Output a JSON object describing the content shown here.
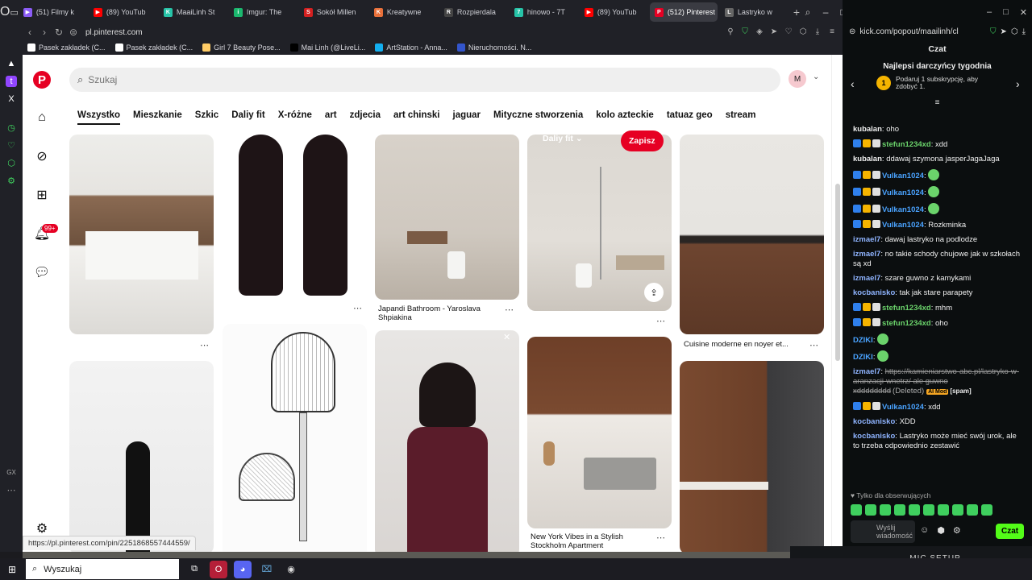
{
  "browser": {
    "tabs": [
      {
        "label": "(51) Filmy k",
        "color": "#8b5cf6",
        "glyph": "▶"
      },
      {
        "label": "(89) YouTub",
        "color": "#ff0000",
        "glyph": "▶"
      },
      {
        "label": "MaaiLinh St",
        "color": "#27c4a8",
        "glyph": "K"
      },
      {
        "label": "Imgur: The",
        "color": "#1bb76e",
        "glyph": "i"
      },
      {
        "label": "Sokół Millen",
        "color": "#d42020",
        "glyph": "S"
      },
      {
        "label": "Kreatywne",
        "color": "#e8703a",
        "glyph": "K"
      },
      {
        "label": "Rozpierdala",
        "color": "#444",
        "glyph": "R"
      },
      {
        "label": "hinowo - 7T",
        "color": "#27c4a8",
        "glyph": "7"
      },
      {
        "label": "(89) YouTub",
        "color": "#ff0000",
        "glyph": "▶"
      },
      {
        "label": "(512) Pinterest",
        "color": "#e60023",
        "glyph": "P",
        "active": true
      },
      {
        "label": "Lastryko w",
        "color": "#666",
        "glyph": "L"
      }
    ],
    "url": "pl.pinterest.com",
    "bookmarks": [
      {
        "label": "Pasek zakładek (C...",
        "color": "#ffffff"
      },
      {
        "label": "Pasek zakładek (C...",
        "color": "#ffffff"
      },
      {
        "label": "Girl 7 Beauty Pose...",
        "color": "#ffcc66"
      },
      {
        "label": "Mai Linh (@LiveLi...",
        "color": "#000000"
      },
      {
        "label": "ArtStation - Anna...",
        "color": "#13aff0"
      },
      {
        "label": "Nieruchomości. N...",
        "color": "#3355cc"
      }
    ],
    "status_url": "https://pl.pinterest.com/pin/2251868557444559/"
  },
  "pinterest": {
    "search_placeholder": "Szukaj",
    "avatar_letter": "M",
    "notification_badge": "99+",
    "filters": [
      "Wszystko",
      "Mieszkanie",
      "Szkic",
      "Daliy fit",
      "X-różne",
      "art",
      "zdjecia",
      "art chinski",
      "jaguar",
      "Mityczne stworzenia",
      "kolo azteckie",
      "tatuaz geo",
      "stream"
    ],
    "active_filter": "Wszystko",
    "board_label": "Daliy fit",
    "save_label": "Zapisz",
    "pins": [
      {
        "title": "Japandi Bathroom - Yaroslava Shpiakina"
      },
      {
        "title": "Cuisine moderne en noyer et..."
      },
      {
        "title": "New York Vibes in a Stylish Stockholm Apartment"
      }
    ],
    "accent": "#e60023"
  },
  "chat": {
    "url": "kick.com/popout/maailinh/cl",
    "title": "Czat",
    "top_gifters_title": "Najlepsi darczyńcy tygodnia",
    "gifter_badge": "1",
    "gifter_text": "Podaruj 1 subskrypcję, aby zdobyć 1.",
    "messages": [
      {
        "user": "kubalan",
        "text": "oho",
        "color": "#f0f0f0",
        "badges": false
      },
      {
        "user": "stefun1234xd",
        "text": "xdd",
        "color": "#6bd36b",
        "badges": true
      },
      {
        "user": "kubalan",
        "text": "ddawaj szymona jasperJagaJaga",
        "color": "#f0f0f0",
        "badges": false
      },
      {
        "user": "Vulkan1024",
        "text": "",
        "color": "#4aa3ff",
        "badges": true,
        "emote": true
      },
      {
        "user": "Vulkan1024",
        "text": "",
        "color": "#4aa3ff",
        "badges": true,
        "emote": true
      },
      {
        "user": "Vulkan1024",
        "text": "",
        "color": "#4aa3ff",
        "badges": true,
        "emote": true
      },
      {
        "user": "Vulkan1024",
        "text": "Rozkminka",
        "color": "#4aa3ff",
        "badges": true
      },
      {
        "user": "izmael7",
        "text": "dawaj lastryko na podlodze",
        "color": "#8fb4ff",
        "badges": false
      },
      {
        "user": "izmael7",
        "text": "no takie schody chujowe jak w szkołach są xd",
        "color": "#8fb4ff",
        "badges": false
      },
      {
        "user": "izmael7",
        "text": "szare guwno z kamykami",
        "color": "#8fb4ff",
        "badges": false
      },
      {
        "user": "kocbanisko",
        "text": "tak jak stare parapety",
        "color": "#8fb4ff",
        "badges": false
      },
      {
        "user": "stefun1234xd",
        "text": "mhm",
        "color": "#6bd36b",
        "badges": true
      },
      {
        "user": "stefun1234xd",
        "text": "oho",
        "color": "#6bd36b",
        "badges": true
      },
      {
        "user": "DZIKI",
        "text": "",
        "color": "#4aa3ff",
        "badges": false,
        "emote": true
      },
      {
        "user": "DZIKI",
        "text": "",
        "color": "#4aa3ff",
        "badges": false,
        "emote": true
      },
      {
        "user": "izmael7",
        "text": "https://kamieniarstwo-abc.pl/lastryko-w-aranzacji-wnetrz/ ale guwno xdddddddd",
        "color": "#8fb4ff",
        "badges": false,
        "deleted": true
      },
      {
        "user": "Vulkan1024",
        "text": "xdd",
        "color": "#4aa3ff",
        "badges": true
      },
      {
        "user": "kocbanisko",
        "text": "XDD",
        "color": "#8fb4ff",
        "badges": false
      },
      {
        "user": "kocbanisko",
        "text": "Lastryko może mieć swój urok, ale to trzeba odpowiednio zestawić",
        "color": "#8fb4ff",
        "badges": false
      }
    ],
    "deleted_label": "(Deleted)",
    "mod_tag": "AI Mod",
    "spam_tag": "[spam]",
    "followers_only": "Tylko dla obserwujących",
    "input_placeholder": "Wyślij wiadomość",
    "send_label": "Czat",
    "accent": "#53fc18"
  },
  "overlay": {
    "mic_setup": "MIC SETUP"
  },
  "taskbar": {
    "search_label": "Wyszukaj"
  }
}
